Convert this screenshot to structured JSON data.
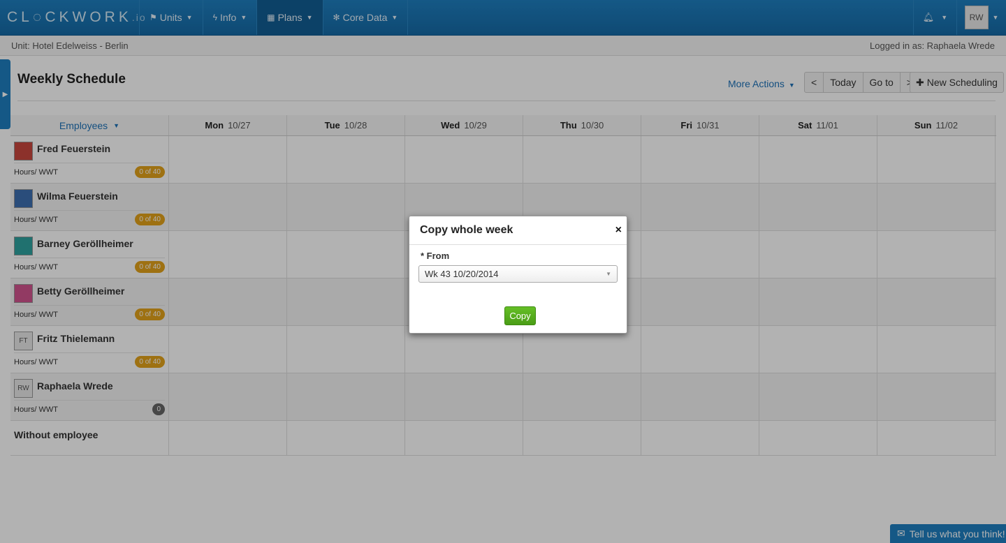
{
  "brand": {
    "name": "CL◌CKWORK",
    "suffix": ".io"
  },
  "nav": {
    "items": [
      {
        "label": "Units",
        "icon": "flag-icon"
      },
      {
        "label": "Info",
        "icon": "bolt-icon"
      },
      {
        "label": "Plans",
        "icon": "calendar-icon"
      },
      {
        "label": "Core Data",
        "icon": "gear-icon"
      }
    ],
    "user_initials": "RW"
  },
  "subbar": {
    "unit": "Unit: Hotel Edelweiss - Berlin",
    "logged_in": "Logged in as: Raphaela Wrede"
  },
  "page": {
    "title": "Weekly Schedule",
    "more_actions": "More Actions",
    "prev": "<",
    "today": "Today",
    "goto": "Go to",
    "next": ">",
    "new_scheduling": "New Scheduling"
  },
  "grid": {
    "employees_label": "Employees",
    "days": [
      {
        "name": "Mon",
        "date": "10/27"
      },
      {
        "name": "Tue",
        "date": "10/28"
      },
      {
        "name": "Wed",
        "date": "10/29"
      },
      {
        "name": "Thu",
        "date": "10/30"
      },
      {
        "name": "Fri",
        "date": "10/31"
      },
      {
        "name": "Sat",
        "date": "11/01"
      },
      {
        "name": "Sun",
        "date": "11/02"
      }
    ],
    "employees": [
      {
        "name": "Fred Feuerstein",
        "hours_label": "Hours/ WWT",
        "badge": "0 of 40",
        "pic": ""
      },
      {
        "name": "Wilma Feuerstein",
        "hours_label": "Hours/ WWT",
        "badge": "0 of 40",
        "pic": ""
      },
      {
        "name": "Barney Geröllheimer",
        "hours_label": "Hours/ WWT",
        "badge": "0 of 40",
        "pic": ""
      },
      {
        "name": "Betty Geröllheimer",
        "hours_label": "Hours/ WWT",
        "badge": "0 of 40",
        "pic": ""
      },
      {
        "name": "Fritz Thielemann",
        "hours_label": "Hours/ WWT",
        "badge": "0 of 40",
        "pic": "FT"
      },
      {
        "name": "Raphaela Wrede",
        "hours_label": "Hours/ WWT",
        "badge": "0",
        "pic": "RW"
      }
    ],
    "without_employee": "Without employee"
  },
  "modal": {
    "title": "Copy whole week",
    "close": "×",
    "from_label": "* From",
    "from_value": "Wk 43 10/20/2014",
    "copy_button": "Copy"
  },
  "feedback": "Tell us what you think!",
  "colors": {
    "primary": "#1f7fc0",
    "badge": "#e3a21a",
    "copy_green": "#56ab1c"
  }
}
